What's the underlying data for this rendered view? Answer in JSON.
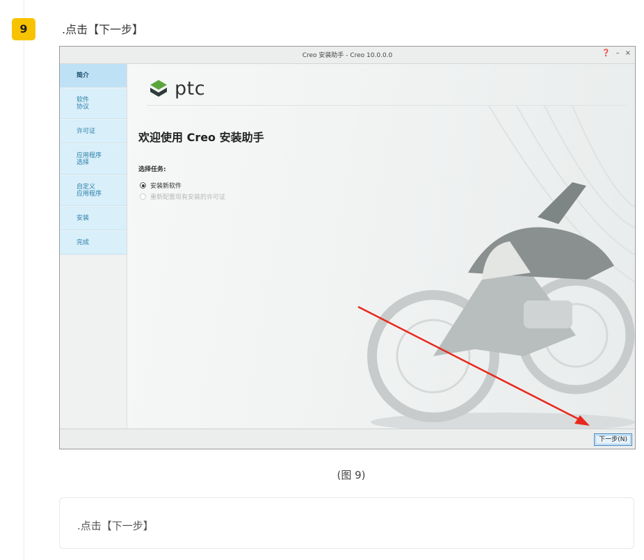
{
  "step": {
    "number": "9",
    "title": ".点击【下一步】"
  },
  "window": {
    "title": "Creo 安装助手 - Creo 10.0.0.0",
    "controls": {
      "help": "❓",
      "minimize": "–",
      "close": "×"
    }
  },
  "sidebar": {
    "items": [
      {
        "label": "简介",
        "active": true
      },
      {
        "label": "软件\n协议"
      },
      {
        "label": "许可证"
      },
      {
        "label": "应用程序\n选择"
      },
      {
        "label": "自定义\n应用程序"
      },
      {
        "label": "安装"
      },
      {
        "label": "完成"
      }
    ]
  },
  "content": {
    "logo_text": "ptc",
    "welcome": "欢迎使用 Creo 安装助手",
    "task_label": "选择任务:",
    "options": [
      {
        "label": "安装新软件",
        "selected": true
      },
      {
        "label": "重新配置现有安装的许可证",
        "disabled": true
      }
    ]
  },
  "footer": {
    "next_button": "下一步(N)"
  },
  "figure_caption": "(图 9)",
  "note_text": ".点击【下一步】",
  "colors": {
    "badge": "#f7c300",
    "sidebar": "#d9effa",
    "arrow": "#e8281c",
    "logo": "#5aa63d"
  },
  "icons": [
    "ptc-logo-icon",
    "help-icon",
    "minimize-icon",
    "close-icon",
    "radio-icon",
    "red-arrow-annotation"
  ]
}
